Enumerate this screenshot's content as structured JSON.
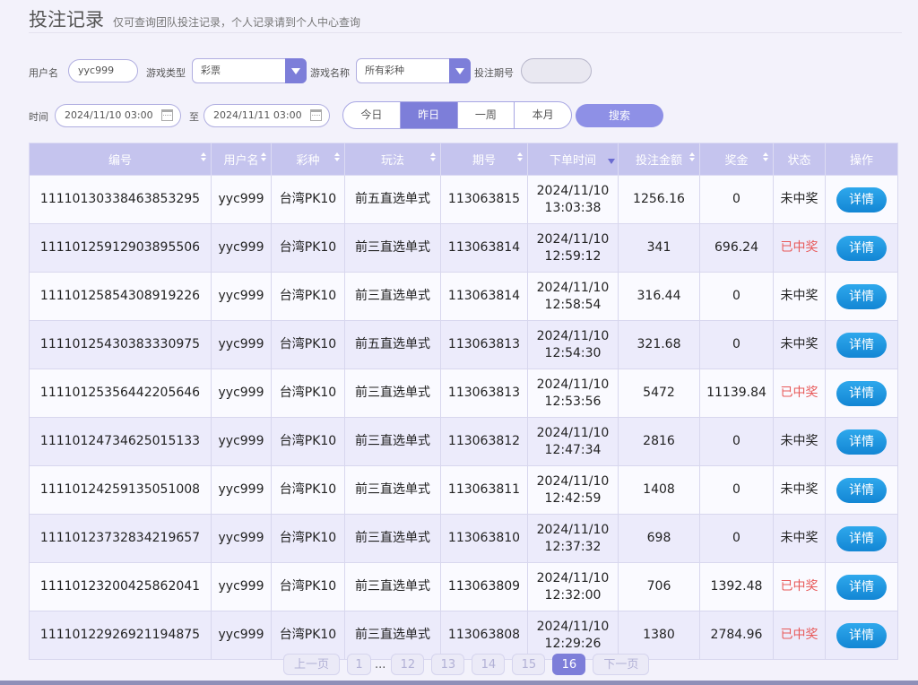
{
  "header": {
    "title": "投注记录",
    "subtitle": "仅可查询团队投注记录，个人记录请到个人中心查询"
  },
  "filters": {
    "username_label": "用户名",
    "username_value": "yyc999",
    "game_type_label": "游戏类型",
    "game_type_value": "彩票",
    "game_name_label": "游戏名称",
    "game_name_value": "所有彩种",
    "period_label": "投注期号",
    "period_value": "",
    "time_label": "时间",
    "start_time": "2024/11/10 03:00",
    "to_label": "至",
    "end_time": "2024/11/11 03:00",
    "quick_ranges": [
      "今日",
      "昨日",
      "一周",
      "本月"
    ],
    "active_range": "昨日",
    "search_label": "搜索"
  },
  "table": {
    "headers": [
      "编号",
      "用户名",
      "彩种",
      "玩法",
      "期号",
      "下单时间",
      "投注金额",
      "奖金",
      "状态",
      "操作"
    ],
    "detail_label": "详情",
    "rows": [
      {
        "id": "1111013033846385329 5",
        "user": "yyc999",
        "lottery": "台湾PK10",
        "play": "前五直选单式",
        "period": "113063815",
        "date": "2024/11/10",
        "time": "13:03:38",
        "amount": "1256.16",
        "prize": "0",
        "status": "未中奖"
      },
      {
        "id": "11110125912903895506",
        "user": "yyc999",
        "lottery": "台湾PK10",
        "play": "前三直选单式",
        "period": "113063814",
        "date": "2024/11/10",
        "time": "12:59:12",
        "amount": "341",
        "prize": "696.24",
        "status": "已中奖"
      },
      {
        "id": "11110125854308919226",
        "user": "yyc999",
        "lottery": "台湾PK10",
        "play": "前三直选单式",
        "period": "113063814",
        "date": "2024/11/10",
        "time": "12:58:54",
        "amount": "316.44",
        "prize": "0",
        "status": "未中奖"
      },
      {
        "id": "11110125430383330975",
        "user": "yyc999",
        "lottery": "台湾PK10",
        "play": "前五直选单式",
        "period": "113063813",
        "date": "2024/11/10",
        "time": "12:54:30",
        "amount": "321.68",
        "prize": "0",
        "status": "未中奖"
      },
      {
        "id": "11110125356442205646",
        "user": "yyc999",
        "lottery": "台湾PK10",
        "play": "前三直选单式",
        "period": "113063813",
        "date": "2024/11/10",
        "time": "12:53:56",
        "amount": "5472",
        "prize": "11139.84",
        "status": "已中奖"
      },
      {
        "id": "11110124734625015133",
        "user": "yyc999",
        "lottery": "台湾PK10",
        "play": "前三直选单式",
        "period": "113063812",
        "date": "2024/11/10",
        "time": "12:47:34",
        "amount": "2816",
        "prize": "0",
        "status": "未中奖"
      },
      {
        "id": "11110124259135051008",
        "user": "yyc999",
        "lottery": "台湾PK10",
        "play": "前三直选单式",
        "period": "113063811",
        "date": "2024/11/10",
        "time": "12:42:59",
        "amount": "1408",
        "prize": "0",
        "status": "未中奖"
      },
      {
        "id": "11110123732834219657",
        "user": "yyc999",
        "lottery": "台湾PK10",
        "play": "前三直选单式",
        "period": "113063810",
        "date": "2024/11/10",
        "time": "12:37:32",
        "amount": "698",
        "prize": "0",
        "status": "未中奖"
      },
      {
        "id": "11110123200425862041",
        "user": "yyc999",
        "lottery": "台湾PK10",
        "play": "前三直选单式",
        "period": "113063809",
        "date": "2024/11/10",
        "time": "12:32:00",
        "amount": "706",
        "prize": "1392.48",
        "status": "已中奖"
      },
      {
        "id": "11110122926921194875",
        "user": "yyc999",
        "lottery": "台湾PK10",
        "play": "前三直选单式",
        "period": "113063808",
        "date": "2024/11/10",
        "time": "12:29:26",
        "amount": "1380",
        "prize": "2784.96",
        "status": "已中奖"
      }
    ]
  },
  "pagination": {
    "prev": "上一页",
    "first": "1",
    "ellipsis": "...",
    "pages": [
      "12",
      "13",
      "14",
      "15",
      "16"
    ],
    "current": "16",
    "next": "下一页"
  },
  "colors": {
    "accent": "#7d7ed9",
    "won": "#e85a5a",
    "detail_button": "#1f97e2"
  }
}
